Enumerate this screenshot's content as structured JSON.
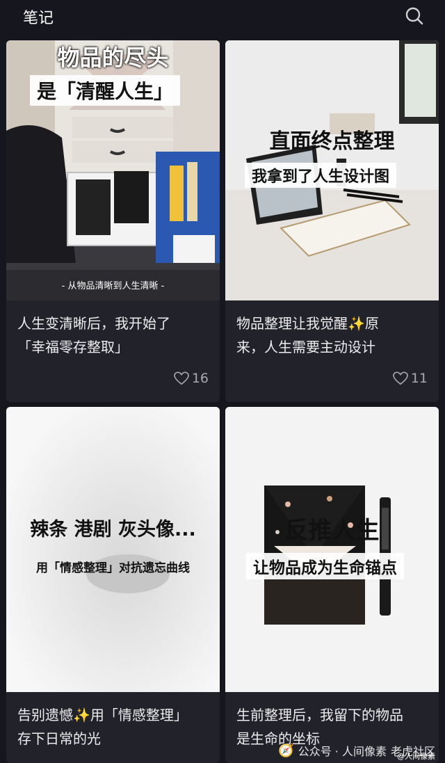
{
  "header": {
    "title": "笔记",
    "search_icon": "search-icon"
  },
  "notes": [
    {
      "image_title": "物品的尽头",
      "image_subtitle": "是「清醒人生」",
      "image_footer": "-  从物品清晰到人生清晰  -",
      "caption_line1": "人生变清晰后，我开始了",
      "caption_line2": "「幸福零存整取」",
      "likes": "16"
    },
    {
      "image_title": "直面终点整理",
      "image_subtitle": "我拿到了人生设计图",
      "caption_line1": "物品整理让我觉醒✨原",
      "caption_line2": "来，人生需要主动设计",
      "likes": "11"
    },
    {
      "image_title": "辣条 港剧 灰头像...",
      "image_subtitle": "用「情感整理」对抗遗忘曲线",
      "caption_line1": "告别遗憾✨用「情感整理」",
      "caption_line2": "存下日常的光"
    },
    {
      "image_title": "反推人生",
      "image_subtitle": "让物品成为生命锚点",
      "caption_line1": "生前整理后，我留下的物品",
      "caption_line2": "是生命的坐标"
    }
  ],
  "watermark": {
    "text": "公众号 · 人间像素",
    "brand": "老虎社区",
    "badge": "@人间像素"
  },
  "colors": {
    "background": "#16161e",
    "card": "#22222b",
    "text": "#ededed",
    "muted": "#a8a8b0"
  }
}
